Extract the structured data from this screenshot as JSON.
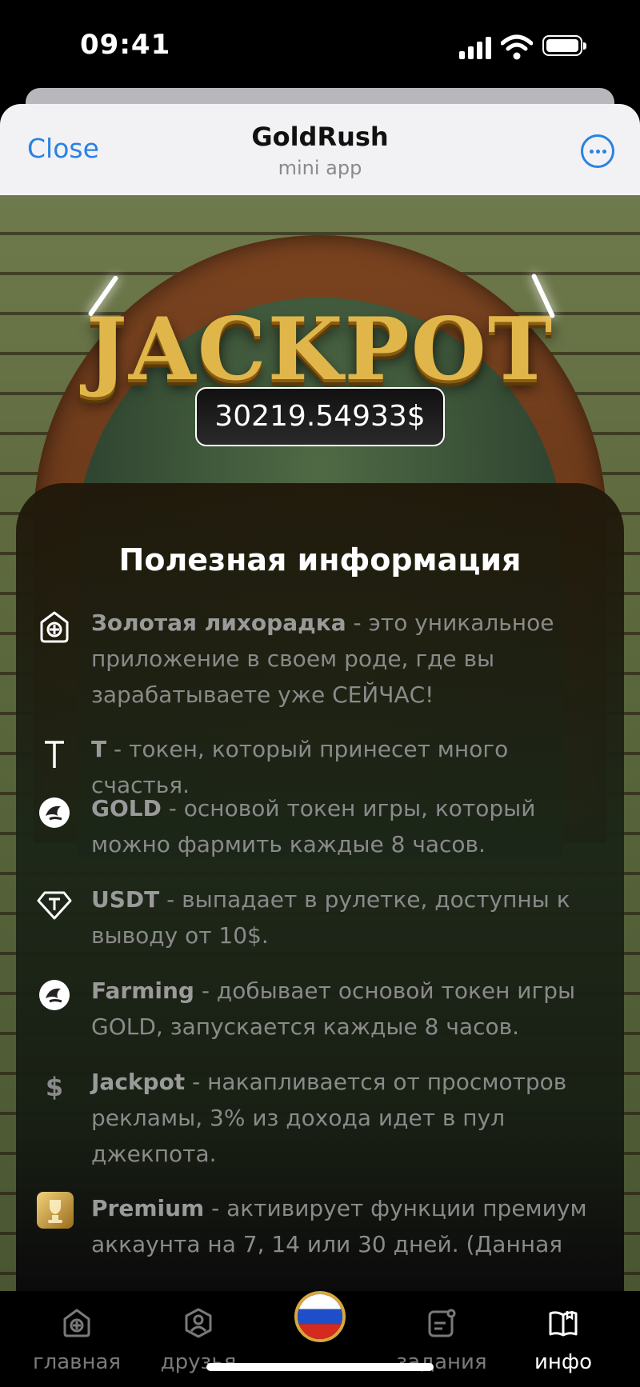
{
  "status_bar": {
    "time": "09:41"
  },
  "header": {
    "close_label": "Close",
    "title": "GoldRush",
    "subtitle": "mini app"
  },
  "jackpot": {
    "logo_text": "JACKPOT",
    "amount": "30219.54933$"
  },
  "info": {
    "title": "Полезная информация",
    "items": [
      {
        "icon": "home-plus-icon",
        "name": "Золотая лихорадка",
        "desc": " - это уникальное приложение в своем роде, где вы зарабатываете уже СЕЙЧАС!"
      },
      {
        "icon": "t-token-icon",
        "name": "T",
        "desc": " - токен, который принесет много счастья."
      },
      {
        "icon": "gold-coin-icon",
        "name": "GOLD",
        "desc": " - основой токен игры, который можно фармить каждые 8 часов."
      },
      {
        "icon": "usdt-icon",
        "name": "USDT",
        "desc": " - выпадает в рулетке, доступны к выводу от 10$."
      },
      {
        "icon": "farming-icon",
        "name": "Farming",
        "desc": " - добывает основой токен игры GOLD, запускается каждые 8 часов."
      },
      {
        "icon": "dollar-icon",
        "name": "Jackpot",
        "desc": " - накапливается от просмотров рекламы, 3% из дохода идет в пул джекпота."
      },
      {
        "icon": "premium-icon",
        "name": "Premium",
        "desc": " - активирует функции премиум аккаунта на 7, 14 или 30 дней. (Данная"
      }
    ]
  },
  "nav": {
    "items": [
      {
        "label": "главная",
        "icon": "home-icon"
      },
      {
        "label": "друзья",
        "icon": "friends-icon"
      },
      {
        "label": "",
        "icon": "russia-flag-icon"
      },
      {
        "label": "задания",
        "icon": "tasks-icon"
      },
      {
        "label": "инфо",
        "icon": "book-icon",
        "active": true
      }
    ]
  },
  "colors": {
    "accent": "#2a82e4",
    "gold": "#e0b64a",
    "muted_text": "#8a8a8a"
  }
}
